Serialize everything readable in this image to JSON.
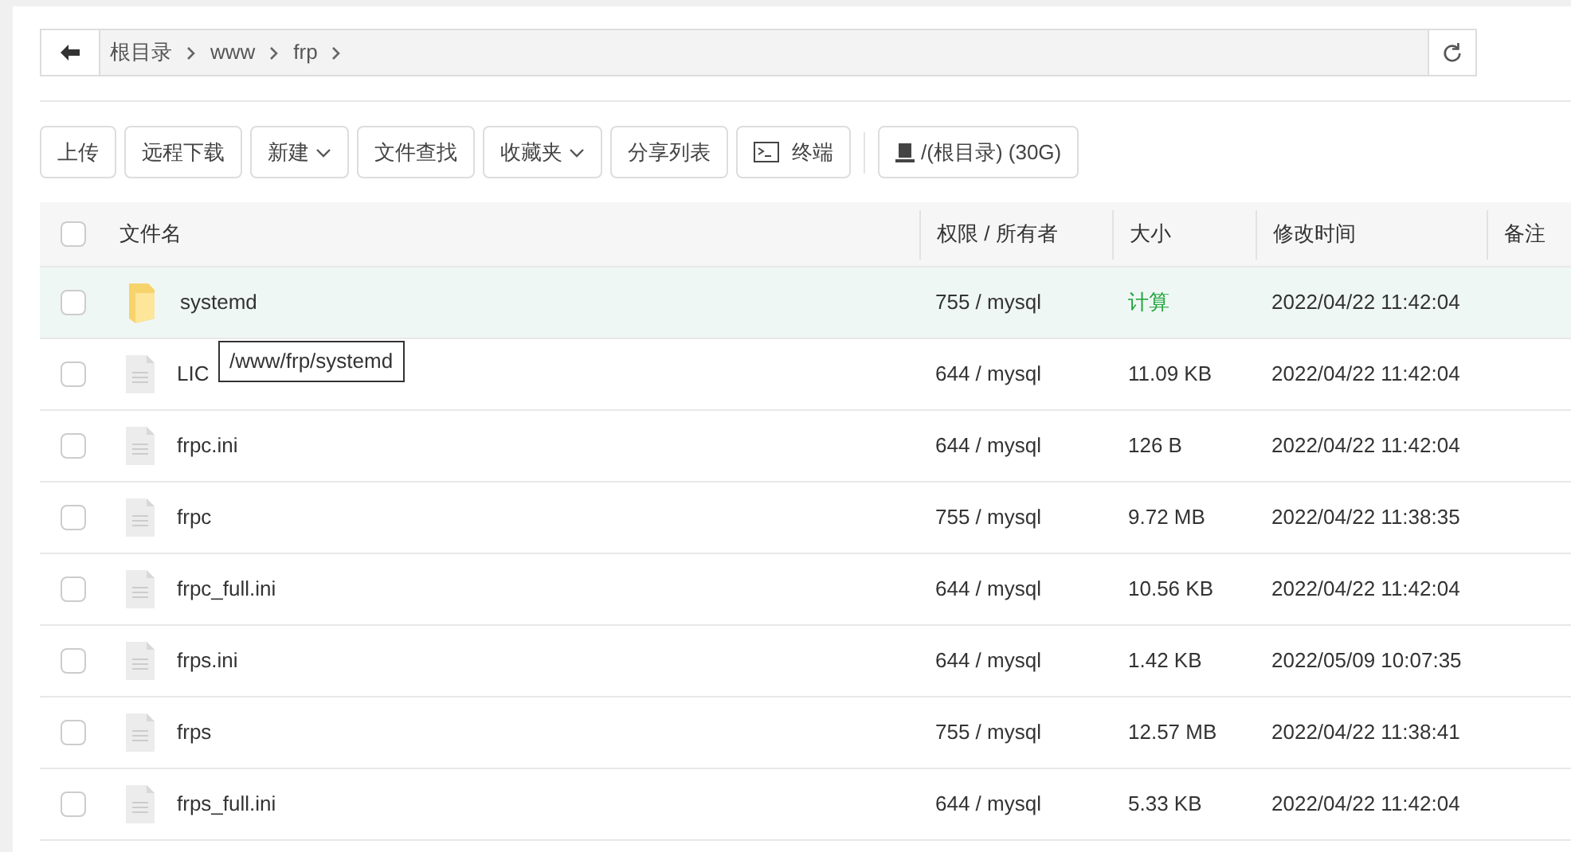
{
  "breadcrumb": [
    "根目录",
    "www",
    "frp"
  ],
  "toolbar": [
    {
      "label": "上传",
      "kind": "plain"
    },
    {
      "label": "远程下载",
      "kind": "plain"
    },
    {
      "label": "新建",
      "kind": "dropdown"
    },
    {
      "label": "文件查找",
      "kind": "plain"
    },
    {
      "label": "收藏夹",
      "kind": "dropdown"
    },
    {
      "label": "分享列表",
      "kind": "plain"
    },
    {
      "label": "终端",
      "kind": "terminal"
    },
    {
      "label": "/(根目录) (30G)",
      "kind": "disk"
    }
  ],
  "select_all_checked": false,
  "columns": [
    "文件名",
    "权限 / 所有者",
    "大小",
    "修改时间",
    "备注"
  ],
  "rows": [
    {
      "kind": "folder",
      "name": "systemd",
      "perm": "755 / mysql",
      "size": "计算",
      "size_action": true,
      "time": "2022/04/22 11:42:04",
      "selected": true,
      "checked": false
    },
    {
      "kind": "file",
      "name": "LIC",
      "perm": "644 / mysql",
      "size": "11.09 KB",
      "size_action": false,
      "time": "2022/04/22 11:42:04",
      "selected": false,
      "checked": false
    },
    {
      "kind": "file",
      "name": "frpc.ini",
      "perm": "644 / mysql",
      "size": "126 B",
      "size_action": false,
      "time": "2022/04/22 11:42:04",
      "selected": false,
      "checked": false
    },
    {
      "kind": "file",
      "name": "frpc",
      "perm": "755 / mysql",
      "size": "9.72 MB",
      "size_action": false,
      "time": "2022/04/22 11:38:35",
      "selected": false,
      "checked": false
    },
    {
      "kind": "file",
      "name": "frpc_full.ini",
      "perm": "644 / mysql",
      "size": "10.56 KB",
      "size_action": false,
      "time": "2022/04/22 11:42:04",
      "selected": false,
      "checked": false
    },
    {
      "kind": "file",
      "name": "frps.ini",
      "perm": "644 / mysql",
      "size": "1.42 KB",
      "size_action": false,
      "time": "2022/05/09 10:07:35",
      "selected": false,
      "checked": false
    },
    {
      "kind": "file",
      "name": "frps",
      "perm": "755 / mysql",
      "size": "12.57 MB",
      "size_action": false,
      "time": "2022/04/22 11:38:41",
      "selected": false,
      "checked": false
    },
    {
      "kind": "file",
      "name": "frps_full.ini",
      "perm": "644 / mysql",
      "size": "5.33 KB",
      "size_action": false,
      "time": "2022/04/22 11:42:04",
      "selected": false,
      "checked": false
    }
  ],
  "tooltip": "/www/frp/systemd"
}
